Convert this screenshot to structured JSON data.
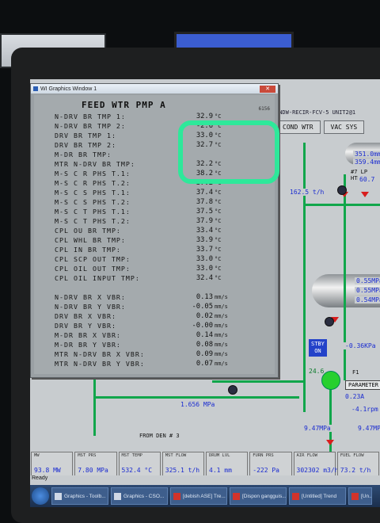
{
  "window": {
    "title": "WI Graphics Window 1",
    "heading": "FEED WTR PMP A",
    "code": "6156"
  },
  "rows": [
    {
      "name": "N-DRV BR TMP 1:",
      "value": "32.9",
      "unit": "°C"
    },
    {
      "name": "N-DRV BR TMP 2:",
      "value": "-2.6",
      "unit": "°C"
    },
    {
      "name": "DRV BR TMP 1:",
      "value": "33.0",
      "unit": "°C"
    },
    {
      "name": "DRV BR TMP 2:",
      "value": "32.7",
      "unit": "°C"
    },
    {
      "name": "M-DR BR TMP:",
      "value": "",
      "unit": ""
    },
    {
      "name": "MTR N-DRV BR TMP:",
      "value": "32.2",
      "unit": "°C"
    },
    {
      "name": "M-S C R PHS T.1:",
      "value": "38.2",
      "unit": "°C"
    },
    {
      "name": "M-S C R PHS T.2:",
      "value": "37.2",
      "unit": "°C"
    },
    {
      "name": "M-S C S PHS T.1:",
      "value": "37.4",
      "unit": "°C"
    },
    {
      "name": "M-S C S PHS T.2:",
      "value": "37.8",
      "unit": "°C"
    },
    {
      "name": "M-S C T PHS T.1:",
      "value": "37.5",
      "unit": "°C"
    },
    {
      "name": "M-S C T PHS T.2:",
      "value": "37.9",
      "unit": "°C"
    },
    {
      "name": "CPL OU BR TMP:",
      "value": "33.4",
      "unit": "°C"
    },
    {
      "name": "CPL WHL BR TMP:",
      "value": "33.9",
      "unit": "°C"
    },
    {
      "name": "CPL IN BR TMP:",
      "value": "33.7",
      "unit": "°C"
    },
    {
      "name": "CPL SCP OUT TMP:",
      "value": "33.0",
      "unit": "°C"
    },
    {
      "name": "CPL OIL OUT TMP:",
      "value": "33.0",
      "unit": "°C"
    },
    {
      "name": "CPL OIL INPUT TMP:",
      "value": "32.4",
      "unit": "°C"
    },
    {
      "name": "N-DRV BR X VBR:",
      "value": "0.13",
      "unit": "mm/s"
    },
    {
      "name": "N-DRV BR Y VBR:",
      "value": "-0.05",
      "unit": "mm/s"
    },
    {
      "name": "DRV BR X VBR:",
      "value": "0.02",
      "unit": "mm/s"
    },
    {
      "name": "DRV BR Y VBR:",
      "value": "-0.00",
      "unit": "mm/s"
    },
    {
      "name": "M-DR BR X VBR:",
      "value": "0.14",
      "unit": "mm/s"
    },
    {
      "name": "M-DR BR Y VBR:",
      "value": "0.08",
      "unit": "mm/s"
    },
    {
      "name": "MTR N-DRV BR X VBR:",
      "value": "0.09",
      "unit": "mm/s"
    },
    {
      "name": "MTR N-DRV BR Y VBR:",
      "value": "0.07",
      "unit": "mm/s"
    }
  ],
  "dcs": {
    "path": "INDW-RECIR-FCV-5 UNIT2@1",
    "tabs": [
      "COND WTR",
      "VAC SYS"
    ],
    "lp_heater": "#7 LP HTR",
    "values": {
      "tank_top_1": "351.0mm",
      "tank_top_2": "359.4mm",
      "lp_htr_val": "60.7",
      "flow": "162.5 t/h",
      "right_1": "0.55MPa",
      "right_2": "0.55MPa",
      "right_3": "0.54MPa",
      "press_1": "-0.36KPa",
      "flow_2": "0.23A",
      "rpm": "-4.1rpm",
      "press_2": "9.47MPa",
      "press_3": "9.47MPa",
      "pipe_press": "1.656 MPa",
      "small_val": "24.6"
    },
    "stby": [
      "STBY",
      "ON"
    ],
    "pump_label": "F1",
    "param_button": "PARAMETER",
    "from_label": "FROM DEN # 3"
  },
  "statusbar": [
    {
      "label": "MW",
      "value": "93.8 MW"
    },
    {
      "label": "MST PRS",
      "value": "7.80 MPa"
    },
    {
      "label": "MST TEMP",
      "value": "532.4 °C"
    },
    {
      "label": "MST FLOW",
      "value": "325.1 t/h"
    },
    {
      "label": "DRUM LVL",
      "value": "4.1 mm"
    },
    {
      "label": "FURN PRS",
      "value": "-222 Pa"
    },
    {
      "label": "AIR FLOW",
      "value": "302302 m3/h"
    },
    {
      "label": "FUEL FLOW",
      "value": "73.2 t/h"
    }
  ],
  "ready_text": "Ready",
  "taskbar": [
    {
      "label": "Graphics - Toolb..."
    },
    {
      "label": "Graphics - CSO..."
    },
    {
      "label": "[debish ASE] Tre..."
    },
    {
      "label": "[Dispon gangguis..."
    },
    {
      "label": "[Untitled] Trend"
    },
    {
      "label": "[Un..."
    }
  ]
}
